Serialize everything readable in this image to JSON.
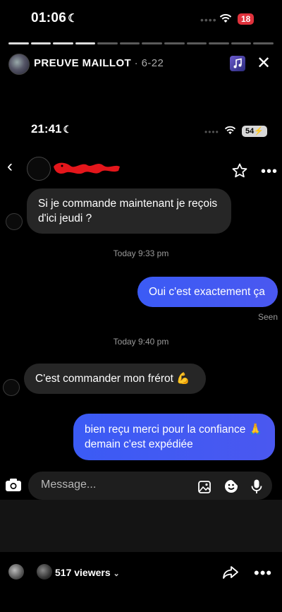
{
  "status_outer": {
    "time": "01:06",
    "battery": "18"
  },
  "story": {
    "username": "PREUVE MAILLOT",
    "age": " · 6-22",
    "progress": {
      "completed": 4,
      "total": 12
    }
  },
  "inner_status": {
    "time": "21:41",
    "battery": "54"
  },
  "messages": [
    {
      "id": "m1",
      "direction": "incoming",
      "text_lines": [
        "Si je commande maintenant je reçois",
        "d'ici jeudi ?"
      ]
    },
    {
      "id": "ts1",
      "type": "timestamp",
      "text": "Today 9:33 pm"
    },
    {
      "id": "m2",
      "direction": "outgoing",
      "text_lines": [
        "Oui c'est exactement ça"
      ]
    },
    {
      "id": "seen",
      "type": "status",
      "text": "Seen"
    },
    {
      "id": "ts2",
      "type": "timestamp",
      "text": "Today 9:40 pm"
    },
    {
      "id": "m3",
      "direction": "incoming",
      "text_lines": [
        "C'est commander mon frérot 💪"
      ]
    },
    {
      "id": "m4",
      "direction": "outgoing",
      "text_lines": [
        "bien reçu merci pour la confiance 🙏",
        "demain c'est expédiée"
      ]
    }
  ],
  "composer": {
    "placeholder": "Message..."
  },
  "footer": {
    "viewers": "517 viewers"
  },
  "colors": {
    "outgoing_bubble": "#3b5bf5",
    "incoming_bubble": "#262626",
    "battery_outer": "#e0323c"
  },
  "icons": [
    "camera-icon",
    "gallery-icon",
    "sticker-icon",
    "microphone-icon",
    "star-icon",
    "share-icon",
    "more-icon",
    "back-icon",
    "close-icon",
    "music-icon"
  ]
}
